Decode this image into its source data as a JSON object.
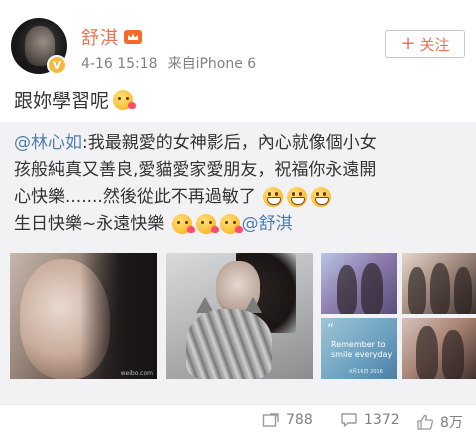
{
  "post": {
    "author": "舒淇",
    "timestamp": "4-16 15:18",
    "source": "来自iPhone 6",
    "follow_label": "关注",
    "text": "跟妳學習呢"
  },
  "repost": {
    "mention": "@林心如",
    "body_line1": ":我最親愛的女神影后，內心就像個小女",
    "body_line2": "孩般純真又善良,愛貓愛家愛朋友，祝福你永遠開",
    "body_line3": "心快樂.......然後從此不再過敏了",
    "body_line4": "生日快樂~永遠快樂",
    "mention_end": "@舒淇",
    "photo_text": "Remember to smile everyday",
    "photo_mark": "weibo.com",
    "photo_date": "4月16日 2016"
  },
  "actions": {
    "repost_count": "788",
    "comment_count": "1372",
    "like_count": "8万"
  },
  "colors": {
    "username": "#eb7350",
    "mention": "#507daf",
    "repost_bg": "#f2f2f5"
  }
}
